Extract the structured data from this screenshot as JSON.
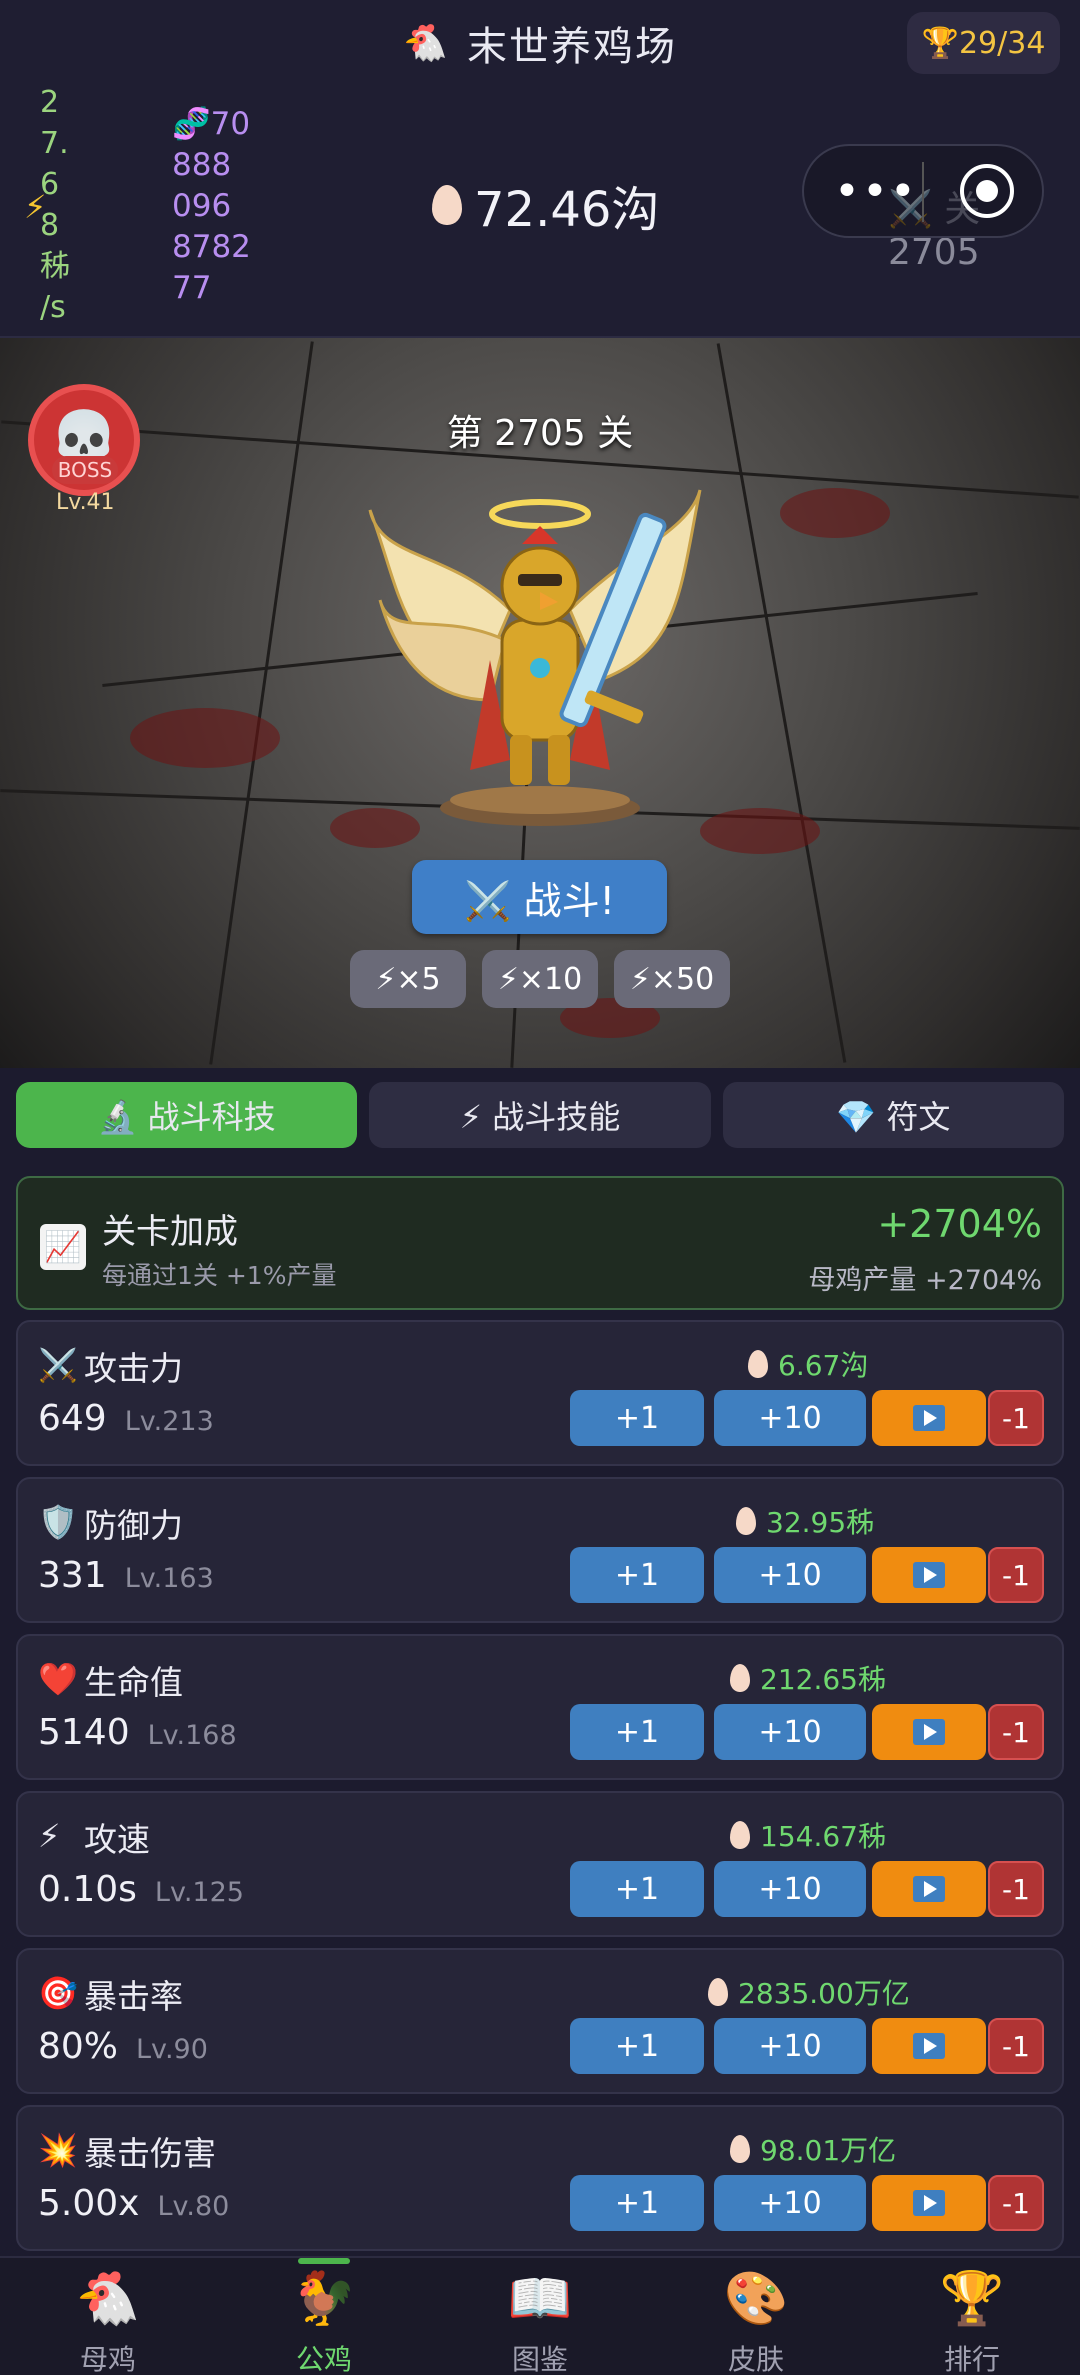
{
  "header": {
    "title": "末世养鸡场",
    "trophy": "🏆29/34",
    "rate_lines": [
      "2",
      "7.",
      "6",
      "8",
      "秭",
      "/s"
    ],
    "dna_lines": [
      "🧬70",
      "888",
      "096",
      "8782",
      "77"
    ],
    "egg_total": "72.46沟",
    "stage_tag": "⚔️ 关 2705"
  },
  "battle": {
    "stage_title": "第 2705 关",
    "boss_label": "BOSS",
    "boss_level": "Lv.41",
    "fight_label": "⚔️ 战斗!",
    "multipliers": [
      "⚡×5",
      "⚡×10",
      "⚡×50"
    ]
  },
  "tabs": [
    {
      "label": "🔬 战斗科技"
    },
    {
      "label": "⚡ 战斗技能"
    },
    {
      "label": "💎 符文"
    }
  ],
  "bonus": {
    "name": "关卡加成",
    "desc": "每通过1关 +1%产量",
    "pct": "+2704%",
    "sub": "母鸡产量 +2704%"
  },
  "stats": [
    {
      "icon": "⚔️",
      "name": "攻击力",
      "value": "649",
      "level": "Lv.213",
      "cost": "6.67沟"
    },
    {
      "icon": "🛡️",
      "name": "防御力",
      "value": "331",
      "level": "Lv.163",
      "cost": "32.95秭"
    },
    {
      "icon": "❤️",
      "name": "生命值",
      "value": "5140",
      "level": "Lv.168",
      "cost": "212.65秭"
    },
    {
      "icon": "⚡",
      "name": "攻速",
      "value": "0.10s",
      "level": "Lv.125",
      "cost": "154.67秭"
    },
    {
      "icon": "🎯",
      "name": "暴击率",
      "value": "80%",
      "level": "Lv.90",
      "cost": "2835.00万亿"
    },
    {
      "icon": "💥",
      "name": "暴击伤害",
      "value": "5.00x",
      "level": "Lv.80",
      "cost": "98.01万亿"
    }
  ],
  "buttons": {
    "plus1": "+1",
    "plus10": "+10",
    "minus1": "-1"
  },
  "nav": [
    {
      "icon": "🐔",
      "label": "母鸡"
    },
    {
      "icon": "🐓",
      "label": "公鸡"
    },
    {
      "icon": "📖",
      "label": "图鉴"
    },
    {
      "icon": "🎨",
      "label": "皮肤"
    },
    {
      "icon": "🏆",
      "label": "排行"
    }
  ]
}
